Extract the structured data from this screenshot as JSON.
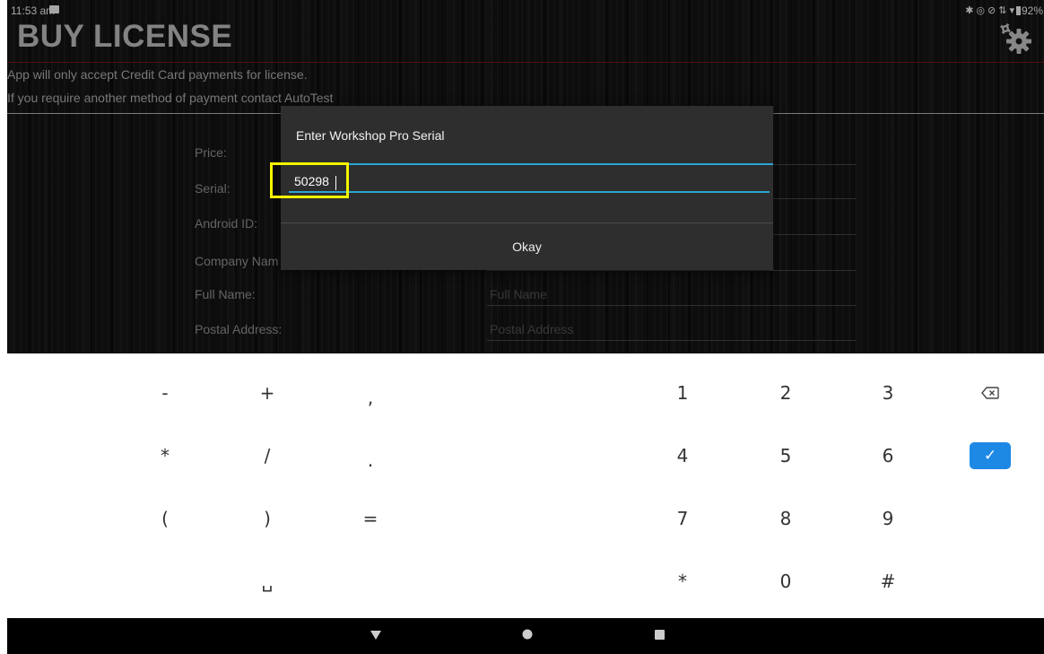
{
  "status_bar": {
    "time": "11:53 am",
    "battery": "92%"
  },
  "header": {
    "title": "BUY LICENSE"
  },
  "notices": [
    "App will only accept Credit Card payments for license.",
    "If you require another method of payment contact AutoTest"
  ],
  "form": {
    "labels": {
      "price": "Price:",
      "serial": "Serial:",
      "android_id": "Android ID:",
      "company_name": "Company Nam",
      "full_name": "Full Name:",
      "postal_address": "Postal Address:"
    },
    "placeholders": {
      "full_name": "Full Name",
      "postal_address": "Postal Address"
    }
  },
  "dialog": {
    "title": "Enter Workshop Pro Serial",
    "serial_value": "50298",
    "okay_label": "Okay"
  },
  "keyboard": {
    "keys": {
      "minus": "-",
      "plus": "+",
      "comma": ",",
      "asterisk": "*",
      "slash": "/",
      "period": ".",
      "open_paren": "(",
      "close_paren": ")",
      "equals": "=",
      "space": "␣",
      "d1": "1",
      "d2": "2",
      "d3": "3",
      "d4": "4",
      "d5": "5",
      "d6": "6",
      "d7": "7",
      "d8": "8",
      "d9": "9",
      "star": "*",
      "d0": "0",
      "hash": "#"
    },
    "icons": {
      "backspace": "backspace-icon",
      "enter": "check-icon"
    },
    "accent_color": "#1e88e5"
  },
  "colors": {
    "dialog_accent": "#2ba5cf",
    "highlight": "#f5f500",
    "title_rule": "#7a1a1a"
  }
}
